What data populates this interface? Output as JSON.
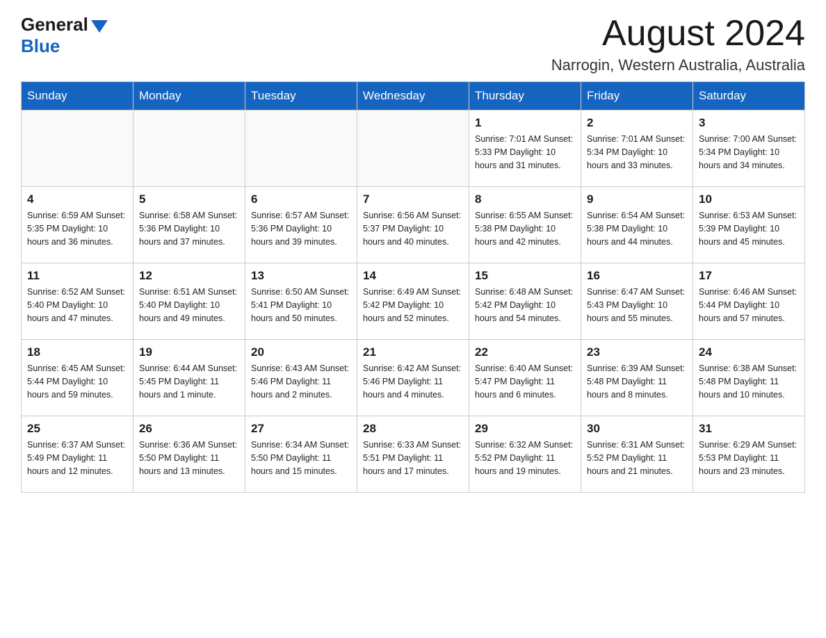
{
  "header": {
    "logo_general": "General",
    "logo_blue": "Blue",
    "month_title": "August 2024",
    "location": "Narrogin, Western Australia, Australia"
  },
  "days_of_week": [
    "Sunday",
    "Monday",
    "Tuesday",
    "Wednesday",
    "Thursday",
    "Friday",
    "Saturday"
  ],
  "weeks": [
    [
      {
        "day": "",
        "info": ""
      },
      {
        "day": "",
        "info": ""
      },
      {
        "day": "",
        "info": ""
      },
      {
        "day": "",
        "info": ""
      },
      {
        "day": "1",
        "info": "Sunrise: 7:01 AM\nSunset: 5:33 PM\nDaylight: 10 hours and 31 minutes."
      },
      {
        "day": "2",
        "info": "Sunrise: 7:01 AM\nSunset: 5:34 PM\nDaylight: 10 hours and 33 minutes."
      },
      {
        "day": "3",
        "info": "Sunrise: 7:00 AM\nSunset: 5:34 PM\nDaylight: 10 hours and 34 minutes."
      }
    ],
    [
      {
        "day": "4",
        "info": "Sunrise: 6:59 AM\nSunset: 5:35 PM\nDaylight: 10 hours and 36 minutes."
      },
      {
        "day": "5",
        "info": "Sunrise: 6:58 AM\nSunset: 5:36 PM\nDaylight: 10 hours and 37 minutes."
      },
      {
        "day": "6",
        "info": "Sunrise: 6:57 AM\nSunset: 5:36 PM\nDaylight: 10 hours and 39 minutes."
      },
      {
        "day": "7",
        "info": "Sunrise: 6:56 AM\nSunset: 5:37 PM\nDaylight: 10 hours and 40 minutes."
      },
      {
        "day": "8",
        "info": "Sunrise: 6:55 AM\nSunset: 5:38 PM\nDaylight: 10 hours and 42 minutes."
      },
      {
        "day": "9",
        "info": "Sunrise: 6:54 AM\nSunset: 5:38 PM\nDaylight: 10 hours and 44 minutes."
      },
      {
        "day": "10",
        "info": "Sunrise: 6:53 AM\nSunset: 5:39 PM\nDaylight: 10 hours and 45 minutes."
      }
    ],
    [
      {
        "day": "11",
        "info": "Sunrise: 6:52 AM\nSunset: 5:40 PM\nDaylight: 10 hours and 47 minutes."
      },
      {
        "day": "12",
        "info": "Sunrise: 6:51 AM\nSunset: 5:40 PM\nDaylight: 10 hours and 49 minutes."
      },
      {
        "day": "13",
        "info": "Sunrise: 6:50 AM\nSunset: 5:41 PM\nDaylight: 10 hours and 50 minutes."
      },
      {
        "day": "14",
        "info": "Sunrise: 6:49 AM\nSunset: 5:42 PM\nDaylight: 10 hours and 52 minutes."
      },
      {
        "day": "15",
        "info": "Sunrise: 6:48 AM\nSunset: 5:42 PM\nDaylight: 10 hours and 54 minutes."
      },
      {
        "day": "16",
        "info": "Sunrise: 6:47 AM\nSunset: 5:43 PM\nDaylight: 10 hours and 55 minutes."
      },
      {
        "day": "17",
        "info": "Sunrise: 6:46 AM\nSunset: 5:44 PM\nDaylight: 10 hours and 57 minutes."
      }
    ],
    [
      {
        "day": "18",
        "info": "Sunrise: 6:45 AM\nSunset: 5:44 PM\nDaylight: 10 hours and 59 minutes."
      },
      {
        "day": "19",
        "info": "Sunrise: 6:44 AM\nSunset: 5:45 PM\nDaylight: 11 hours and 1 minute."
      },
      {
        "day": "20",
        "info": "Sunrise: 6:43 AM\nSunset: 5:46 PM\nDaylight: 11 hours and 2 minutes."
      },
      {
        "day": "21",
        "info": "Sunrise: 6:42 AM\nSunset: 5:46 PM\nDaylight: 11 hours and 4 minutes."
      },
      {
        "day": "22",
        "info": "Sunrise: 6:40 AM\nSunset: 5:47 PM\nDaylight: 11 hours and 6 minutes."
      },
      {
        "day": "23",
        "info": "Sunrise: 6:39 AM\nSunset: 5:48 PM\nDaylight: 11 hours and 8 minutes."
      },
      {
        "day": "24",
        "info": "Sunrise: 6:38 AM\nSunset: 5:48 PM\nDaylight: 11 hours and 10 minutes."
      }
    ],
    [
      {
        "day": "25",
        "info": "Sunrise: 6:37 AM\nSunset: 5:49 PM\nDaylight: 11 hours and 12 minutes."
      },
      {
        "day": "26",
        "info": "Sunrise: 6:36 AM\nSunset: 5:50 PM\nDaylight: 11 hours and 13 minutes."
      },
      {
        "day": "27",
        "info": "Sunrise: 6:34 AM\nSunset: 5:50 PM\nDaylight: 11 hours and 15 minutes."
      },
      {
        "day": "28",
        "info": "Sunrise: 6:33 AM\nSunset: 5:51 PM\nDaylight: 11 hours and 17 minutes."
      },
      {
        "day": "29",
        "info": "Sunrise: 6:32 AM\nSunset: 5:52 PM\nDaylight: 11 hours and 19 minutes."
      },
      {
        "day": "30",
        "info": "Sunrise: 6:31 AM\nSunset: 5:52 PM\nDaylight: 11 hours and 21 minutes."
      },
      {
        "day": "31",
        "info": "Sunrise: 6:29 AM\nSunset: 5:53 PM\nDaylight: 11 hours and 23 minutes."
      }
    ]
  ]
}
